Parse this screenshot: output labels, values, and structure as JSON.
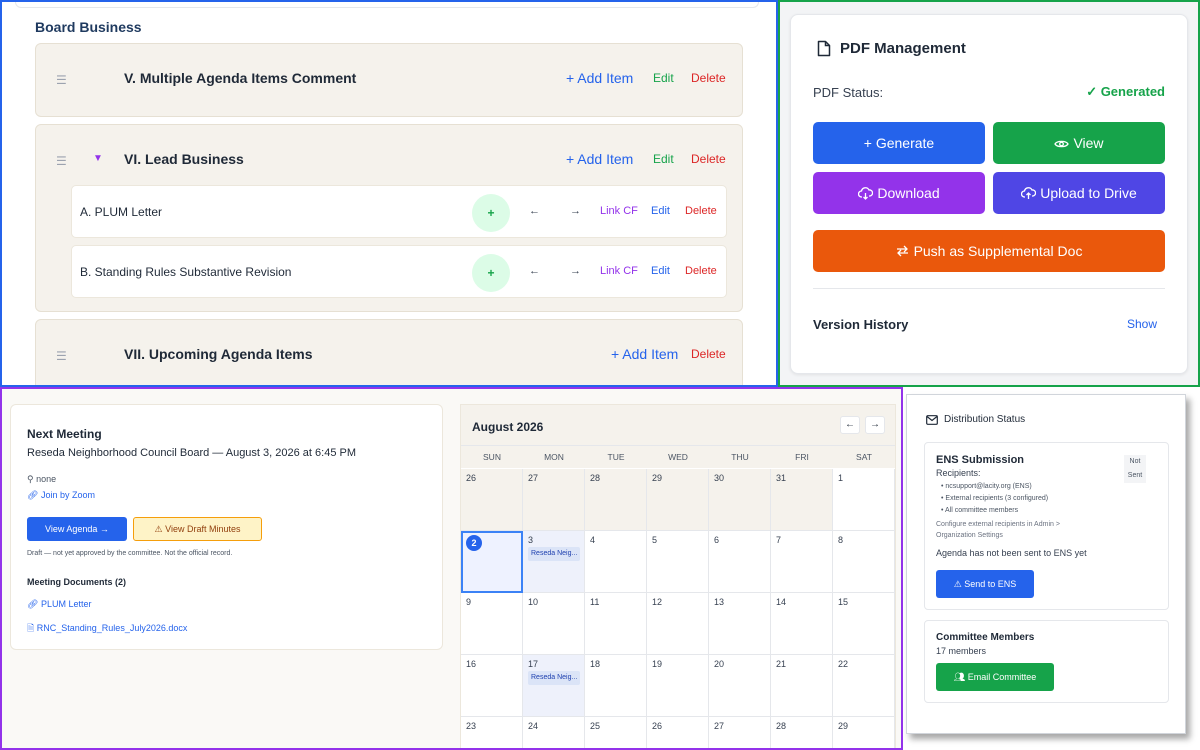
{
  "board": {
    "title": "Board Business",
    "sections": [
      {
        "title": "V.  Multiple Agenda Items Comment",
        "add": "+ Add Item",
        "edit": "Edit",
        "delete": "Delete"
      },
      {
        "title": "VI.  Lead Business",
        "add": "+ Add Item",
        "edit": "Edit",
        "delete": "Delete",
        "items": [
          {
            "label": "A. PLUM Letter",
            "plus": "+",
            "left": "←",
            "right": "→",
            "link": "Link CF",
            "edit": "Edit",
            "delete": "Delete"
          },
          {
            "label": "B. Standing Rules Substantive Revision",
            "plus": "+",
            "left": "←",
            "right": "→",
            "link": "Link CF",
            "edit": "Edit",
            "delete": "Delete"
          }
        ]
      },
      {
        "title": "VII. Upcoming Agenda Items",
        "add": "+ Add Item",
        "delete": "Delete"
      }
    ]
  },
  "pdf": {
    "title": "PDF Management",
    "status_label": "PDF Status:",
    "status_value": "✓ Generated",
    "buttons": {
      "generate": "+ Generate",
      "view": "View",
      "download": "Download",
      "upload": "Upload to Drive",
      "push": "Push as Supplemental Doc"
    },
    "version_history": "Version History",
    "show": "Show",
    "colors": {
      "blue": "#2563eb",
      "green": "#16a34a",
      "purple": "#9333ea",
      "indigo": "#4f46e5",
      "orange": "#ea580c"
    }
  },
  "meeting": {
    "heading": "Next Meeting",
    "subtitle": "Reseda Neighborhood Council Board — August 3, 2026 at 6:45 PM",
    "location": "none",
    "zoom": "Join by Zoom",
    "view_agenda": "View Agenda →",
    "view_minutes": "View Draft Minutes",
    "draft_note": "Draft — not yet approved by the committee. Not the official record.",
    "docs_title": "Meeting Documents (2)",
    "docs": [
      "PLUM Letter",
      "RNC_Standing_Rules_July2026.docx"
    ]
  },
  "calendar": {
    "month": "August 2026",
    "prev": "←",
    "next": "→",
    "dow": [
      "SUN",
      "MON",
      "TUE",
      "WED",
      "THU",
      "FRI",
      "SAT"
    ],
    "weeks": [
      [
        "26",
        "27",
        "28",
        "29",
        "30",
        "31",
        "1"
      ],
      [
        "2",
        "3",
        "4",
        "5",
        "6",
        "7",
        "8"
      ],
      [
        "9",
        "10",
        "11",
        "12",
        "13",
        "14",
        "15"
      ],
      [
        "16",
        "17",
        "18",
        "19",
        "20",
        "21",
        "22"
      ],
      [
        "23",
        "24",
        "25",
        "26",
        "27",
        "28",
        "29"
      ]
    ],
    "event_label": "Reseda Neig..."
  },
  "distribution": {
    "title": "Distribution Status",
    "ens": {
      "title": "ENS Submission",
      "recipients_label": "Recipients:",
      "recipients": [
        "• ncsupport@lacity.org (ENS)",
        "• External recipients (3 configured)",
        "• All committee members"
      ],
      "config_note": "Configure external recipients in Admin > Organization Settings",
      "badge_line1": "Not",
      "badge_line2": "Sent",
      "status": "Agenda has not been sent to ENS yet",
      "button": "Send to ENS"
    },
    "committee": {
      "title": "Committee Members",
      "count": "17 members",
      "button": "Email Committee"
    }
  }
}
